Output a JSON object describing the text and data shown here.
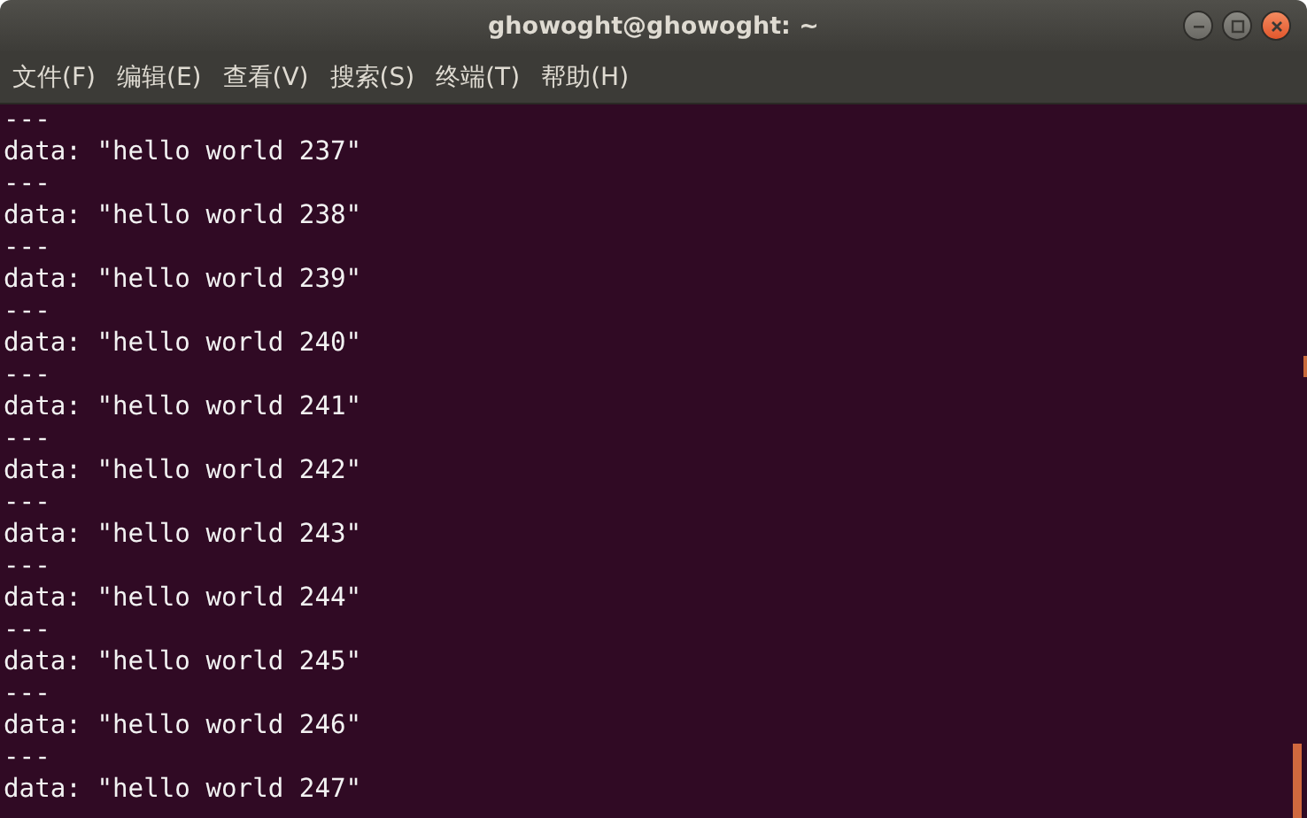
{
  "window": {
    "title": "ghowoght@ghowoght: ~"
  },
  "menu": [
    "文件(F)",
    "编辑(E)",
    "查看(V)",
    "搜索(S)",
    "终端(T)",
    "帮助(H)"
  ],
  "terminal_lines": [
    "---",
    "data: \"hello world 237\"",
    "---",
    "data: \"hello world 238\"",
    "---",
    "data: \"hello world 239\"",
    "---",
    "data: \"hello world 240\"",
    "---",
    "data: \"hello world 241\"",
    "---",
    "data: \"hello world 242\"",
    "---",
    "data: \"hello world 243\"",
    "---",
    "data: \"hello world 244\"",
    "---",
    "data: \"hello world 245\"",
    "---",
    "data: \"hello world 246\"",
    "---",
    "data: \"hello world 247\""
  ]
}
